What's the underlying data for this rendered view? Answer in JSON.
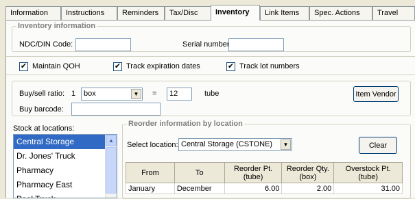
{
  "tabs": [
    "Information",
    "Instructions",
    "Reminders",
    "Tax/Disc",
    "Inventory",
    "Link Items",
    "Spec. Actions",
    "Travel"
  ],
  "inventory_info": {
    "legend": "Inventory information",
    "ndc_label": "NDC/DIN Code:",
    "ndc_value": "",
    "serial_label": "Serial number:",
    "serial_value": "",
    "maintain_qoh": "Maintain QOH",
    "track_expiration": "Track expiration dates",
    "track_lot": "Track lot numbers",
    "check_mark": "✔"
  },
  "buy_sell": {
    "label": "Buy/sell ratio:",
    "qty": "1",
    "unit_select": "box",
    "equals": "=",
    "ratio_value": "12",
    "sell_unit": "tube",
    "barcode_label": "Buy barcode:",
    "barcode_value": "",
    "item_vendor_button": "Item Vendor"
  },
  "stock": {
    "label": "Stock at locations:",
    "locations": [
      "Central Storage",
      "Dr. Jones' Truck",
      "Pharmacy",
      "Pharmacy East",
      "Pool Truck"
    ]
  },
  "reorder": {
    "legend": "Reorder information by location",
    "select_label": "Select location:",
    "select_value": "Central Storage (CSTONE)",
    "clear_button": "Clear",
    "columns": [
      "From",
      "To",
      "Reorder Pt.\n(tube)",
      "Reorder Qty.\n(box)",
      "Overstock Pt.\n(tube)"
    ],
    "rows": [
      [
        "January",
        "December",
        "6.00",
        "2.00",
        "31.00"
      ]
    ]
  }
}
